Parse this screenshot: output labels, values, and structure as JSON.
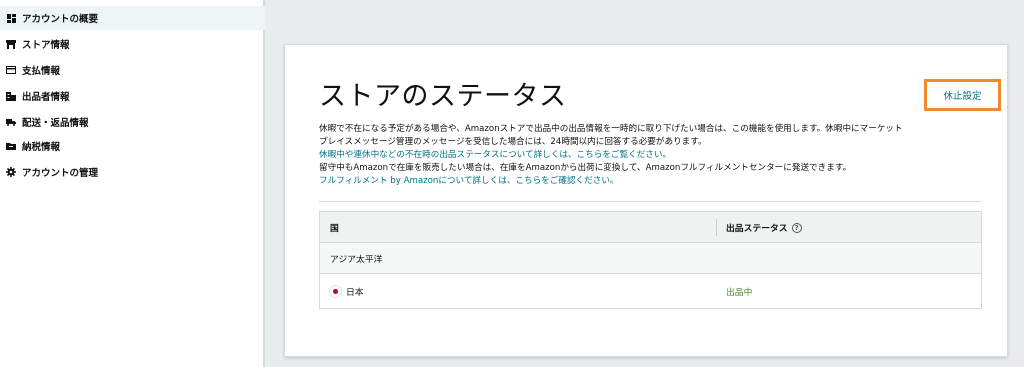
{
  "sidebar": {
    "items": [
      {
        "label": "アカウントの概要",
        "icon": "dashboard-icon",
        "active": true
      },
      {
        "label": "ストア情報",
        "icon": "store-icon",
        "active": false
      },
      {
        "label": "支払情報",
        "icon": "credit-card-icon",
        "active": false
      },
      {
        "label": "出品者情報",
        "icon": "building-icon",
        "active": false
      },
      {
        "label": "配送・返品情報",
        "icon": "truck-icon",
        "active": false
      },
      {
        "label": "納税情報",
        "icon": "folder-icon",
        "active": false
      },
      {
        "label": "アカウントの管理",
        "icon": "gear-icon",
        "active": false
      }
    ]
  },
  "main": {
    "title": "ストアのステータス",
    "suspend_button": "休止設定",
    "description": {
      "line1": "休暇で不在になる予定がある場合や、Amazonストアで出品中の出品情報を一時的に取り下げたい場合は、この機能を使用します。休暇中にマーケット",
      "line2": "プレイスメッセージ管理のメッセージを受信した場合には、24時間以内に回答する必要があります。",
      "link1": "休暇中や連休中などの不在時の出品ステータスについて詳しくは、こちらをご覧ください。",
      "line3": "留守中もAmazonで在庫を販売したい場合は、在庫をAmazonから出荷に変換して、Amazonフルフィルメントセンターに発送できます。",
      "link2": "フルフィルメント by Amazonについて詳しくは、こちらをご確認ください。"
    },
    "table": {
      "headers": {
        "country": "国",
        "status": "出品ステータス"
      },
      "help_icon": "?",
      "group": "アジア太平洋",
      "rows": [
        {
          "country": "日本",
          "flag": "japan-flag-icon",
          "status": "出品中"
        }
      ]
    }
  },
  "colors": {
    "link": "#007185",
    "highlight_border": "#f18a2c",
    "status_active": "#4e8a23",
    "sidebar_active_bg": "#eef5f6"
  }
}
